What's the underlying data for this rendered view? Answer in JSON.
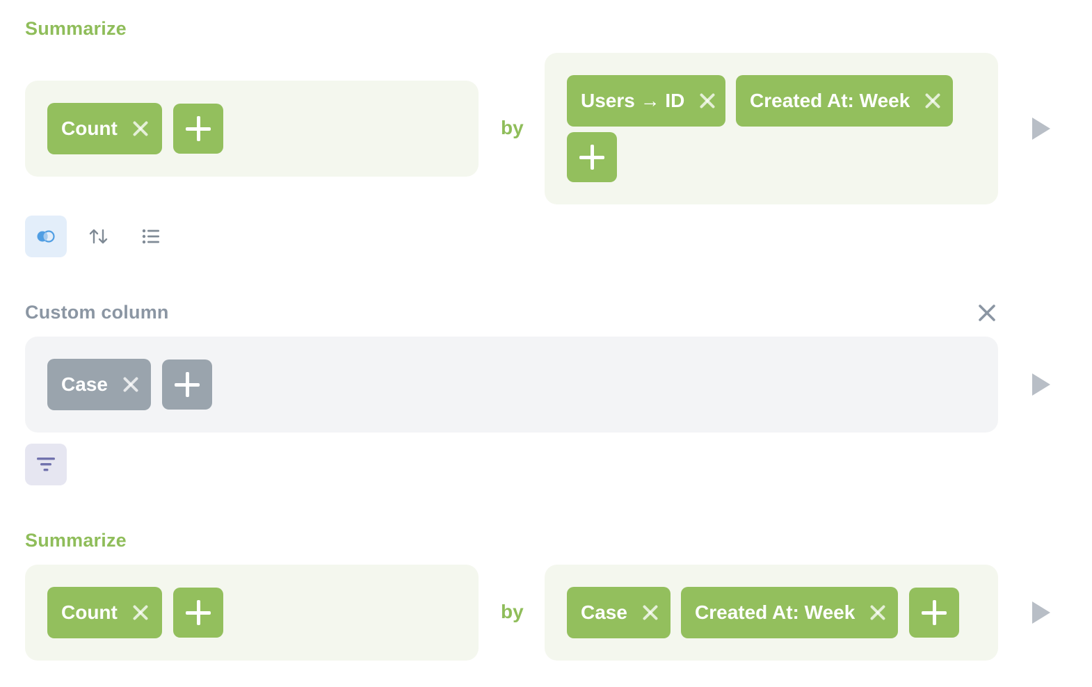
{
  "step1": {
    "title": "Summarize",
    "metrics": [
      {
        "label": "Count"
      }
    ],
    "by_label": "by",
    "breakouts": [
      {
        "label": "Users → ID"
      },
      {
        "label": "Created At: Week"
      }
    ]
  },
  "step1_actions": {
    "icons": [
      "join-icon",
      "sort-icon",
      "list-icon"
    ]
  },
  "step2": {
    "title": "Custom column",
    "expressions": [
      {
        "label": "Case"
      }
    ]
  },
  "step2_actions": {
    "icons": [
      "filter-icon"
    ]
  },
  "step3": {
    "title": "Summarize",
    "metrics": [
      {
        "label": "Count"
      }
    ],
    "by_label": "by",
    "breakouts": [
      {
        "label": "Case"
      },
      {
        "label": "Created At: Week"
      }
    ]
  },
  "colors": {
    "summarize_green": "#93bf5d",
    "custom_column_gray": "#9aa4ad",
    "join_blue": "#509ee3",
    "filter_purple": "#7172ad"
  }
}
